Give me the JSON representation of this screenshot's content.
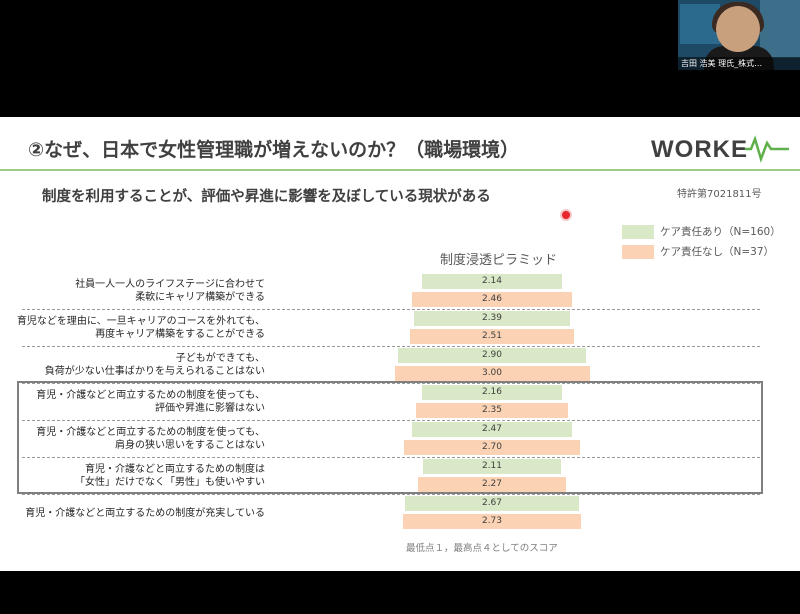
{
  "video": {
    "caption": "吉田 浩美 理氏_株式…"
  },
  "slide": {
    "title": "②なぜ、日本で女性管理職が増えないのか？（職場環境）",
    "subtitle": "制度を利用することが、評価や昇進に影響を及ぼしている現状がある",
    "patent": "特許第7021811号",
    "logo": "WORKEVX",
    "footnote": "最低点１，最高点４としてのスコア",
    "colors": {
      "accent_green": "#9ccc84",
      "pointer_red": "#e8242c",
      "highlight_border": "#7f7f7f"
    }
  },
  "chart_data": {
    "type": "bar",
    "title": "制度浸透ピラミッド",
    "orientation": "horizontal-centered-pyramid",
    "categories": [
      [
        "社員一人一人のライフステージに合わせて",
        "柔軟にキャリア構築ができる"
      ],
      [
        "育児などを理由に、一旦キャリアのコースを外れても、",
        "再度キャリア構築をすることができる"
      ],
      [
        "子どもができても、",
        "負荷が少ない仕事ばかりを与えられることはない"
      ],
      [
        "育児・介護などと両立するための制度を使っても、",
        "評価や昇進に影響はない"
      ],
      [
        "育児・介護などと両立するための制度を使っても、",
        "肩身の狭い思いをすることはない"
      ],
      [
        "育児・介護などと両立するための制度は",
        "「女性」だけでなく「男性」も使いやすい"
      ],
      [
        "育児・介護などと両立するための制度が充実している"
      ]
    ],
    "series": [
      {
        "name": "ケア責任あり（N=160）",
        "color": "#d9e8c6",
        "values": [
          2.14,
          2.39,
          2.9,
          2.16,
          2.47,
          2.11,
          2.67
        ]
      },
      {
        "name": "ケア責任なし（N=37）",
        "color": "#fbd2b3",
        "values": [
          2.46,
          2.51,
          3.0,
          2.35,
          2.7,
          2.27,
          2.73
        ]
      }
    ],
    "value_labels": [
      [
        "2.14",
        "2.39",
        "2.90",
        "2.16",
        "2.47",
        "2.11",
        "2.67"
      ],
      [
        "2.46",
        "2.51",
        "3.00",
        "2.35",
        "2.70",
        "2.27",
        "2.73"
      ]
    ],
    "highlighted_categories": [
      3,
      4,
      5
    ],
    "xlim": [
      0,
      4
    ],
    "legend": "top-right",
    "grid": false
  }
}
